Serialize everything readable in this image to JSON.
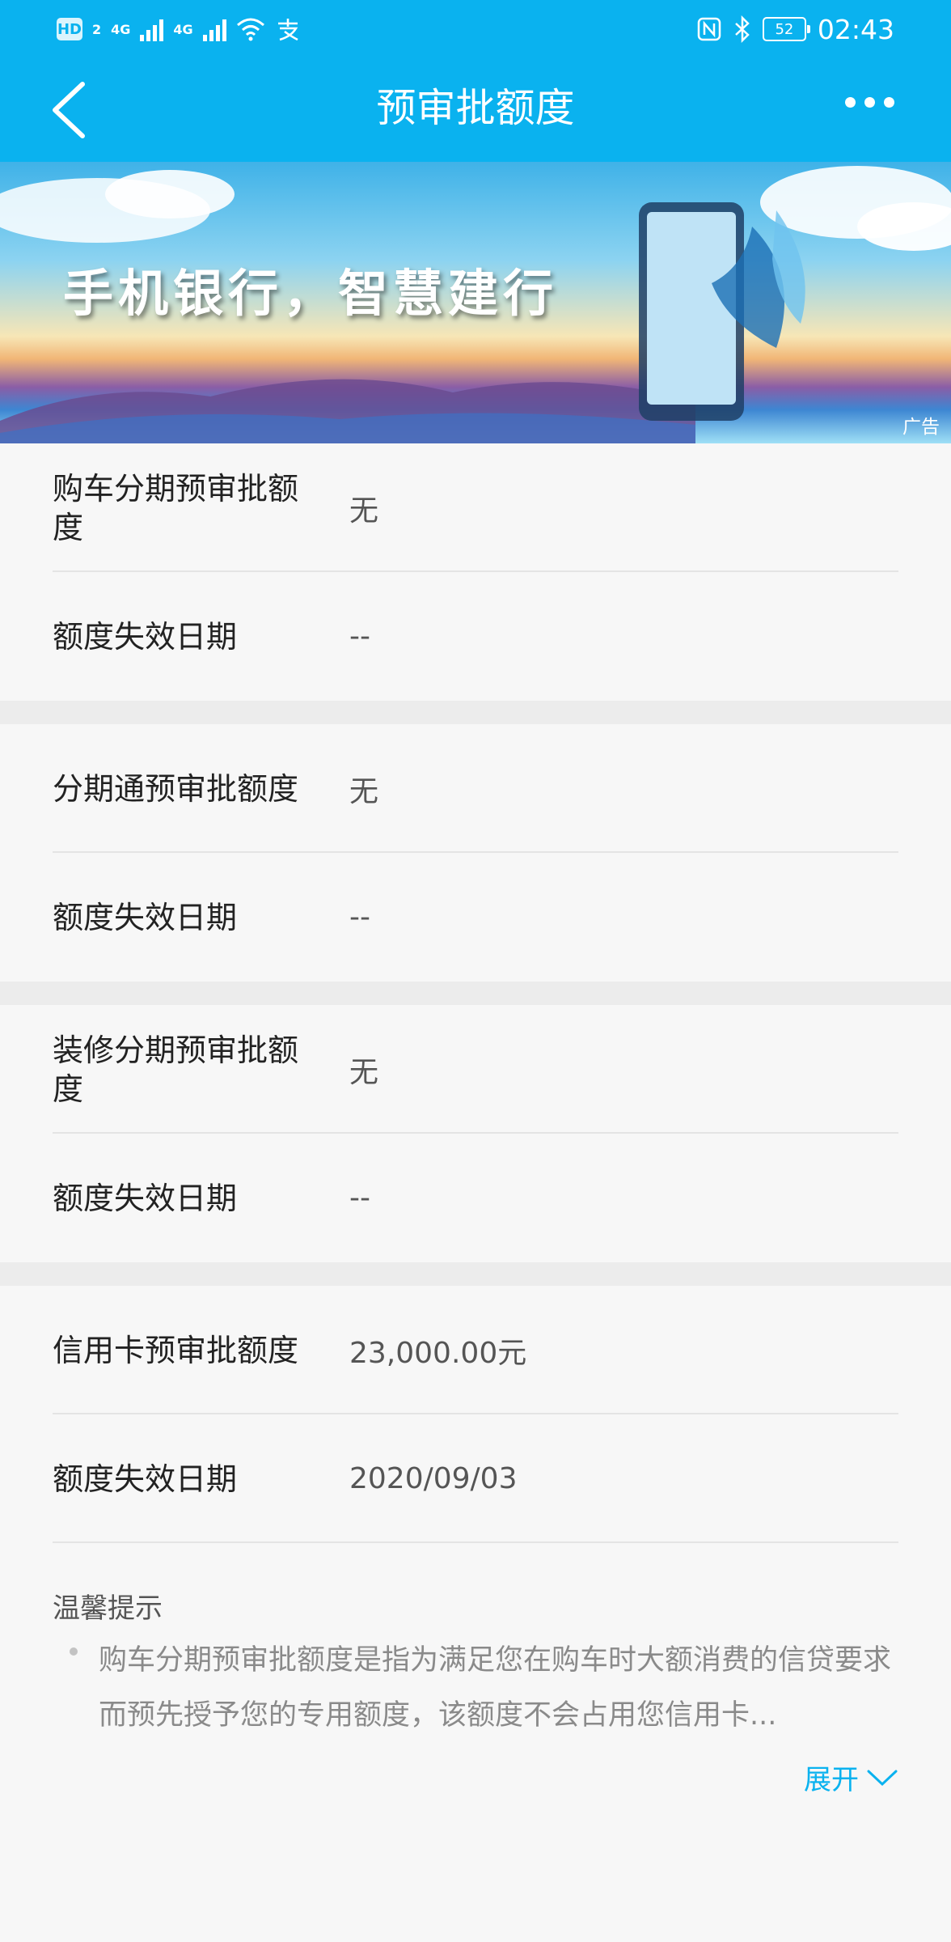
{
  "status_bar": {
    "hd": "HD",
    "hd_sub": "2",
    "net1": "4G",
    "net2": "4G",
    "battery": "52",
    "time": "02:43"
  },
  "header": {
    "title": "预审批额度"
  },
  "banner": {
    "text": "手机银行，智慧建行",
    "ad_label": "广告"
  },
  "sections": [
    {
      "limit_label": "购车分期预审批额度",
      "limit_value": "无",
      "expiry_label": "额度失效日期",
      "expiry_value": "--"
    },
    {
      "limit_label": "分期通预审批额度",
      "limit_value": "无",
      "expiry_label": "额度失效日期",
      "expiry_value": "--"
    },
    {
      "limit_label": "装修分期预审批额度",
      "limit_value": "无",
      "expiry_label": "额度失效日期",
      "expiry_value": "--"
    },
    {
      "limit_label": "信用卡预审批额度",
      "limit_value": "23,000.00元",
      "expiry_label": "额度失效日期",
      "expiry_value": "2020/09/03"
    }
  ],
  "tips": {
    "title": "温馨提示",
    "text": "购车分期预审批额度是指为满足您在购车时大额消费的信贷要求而预先授予您的专用额度，该额度不会占用您信用卡...",
    "expand_label": "展开"
  },
  "colors": {
    "accent": "#0ab2ef",
    "background": "#f7f7f7"
  }
}
